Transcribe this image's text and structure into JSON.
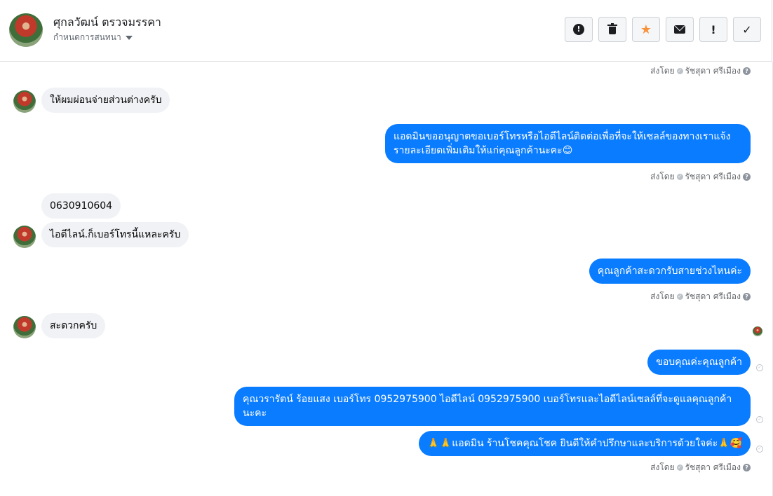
{
  "header": {
    "name": "ศุกลวัฒน์ ตรวจมรรคา",
    "subtitle": "กำหนดการสนทนา",
    "buttons": [
      {
        "name": "spam-button",
        "icon": "alert-circle-icon",
        "glyph": "!"
      },
      {
        "name": "delete-button",
        "icon": "trash-icon",
        "glyph": "🗑"
      },
      {
        "name": "star-button",
        "icon": "star-icon",
        "glyph": "★"
      },
      {
        "name": "mark-unread-button",
        "icon": "envelope-icon",
        "glyph": "✉"
      },
      {
        "name": "follow-up-button",
        "icon": "exclamation-icon",
        "glyph": "!"
      },
      {
        "name": "done-button",
        "icon": "check-icon",
        "glyph": "✓"
      }
    ]
  },
  "sent_by": {
    "prefix": "ส่งโดย",
    "agent": "รัชสุดา ศรีเมือง",
    "info_glyph": "?"
  },
  "messages": [
    {
      "dir": "in",
      "text": "ให้ผมผ่อนจ่ายส่วนต่างครับ"
    },
    {
      "dir": "out",
      "text": "แอดมินขออนุญาตขอเบอร์โทรหรือไอดีไลน์ติดต่อเพื่อที่จะให้เซลล์ของทางเราแจ้งรายละเอียดเพิ่มเติมให้แก่คุณลูกค้านะคะ😊"
    },
    {
      "dir": "in",
      "text": "0630910604"
    },
    {
      "dir": "in",
      "text": "ไอดีไลน์.ก็เบอร์โทรนี้แหละครับ"
    },
    {
      "dir": "out",
      "text": "คุณลูกค้าสะดวกรับสายช่วงไหนค่ะ"
    },
    {
      "dir": "in",
      "text": "สะดวกครับ"
    },
    {
      "dir": "out",
      "text": "ขอบคุณค่ะคุณลูกค้า"
    },
    {
      "dir": "out",
      "text": "คุณวรารัตน์ ร้อยแสง       เบอร์โทร 0952975900  ไอดีไลน์ 0952975900   เบอร์โทรและไอดีไลน์เซลล์ที่จะดูแลคุณลูกค้านะคะ"
    },
    {
      "dir": "out",
      "text": "🙏🙏แอดมิน ร้านโชคคุณโชค ยินดีให้คำปรึกษาและบริการด้วยใจค่ะ🙏🥰"
    }
  ],
  "colors": {
    "outgoing": "#0a7cff",
    "incoming": "#f0f2f5",
    "star": "#f7923a"
  }
}
